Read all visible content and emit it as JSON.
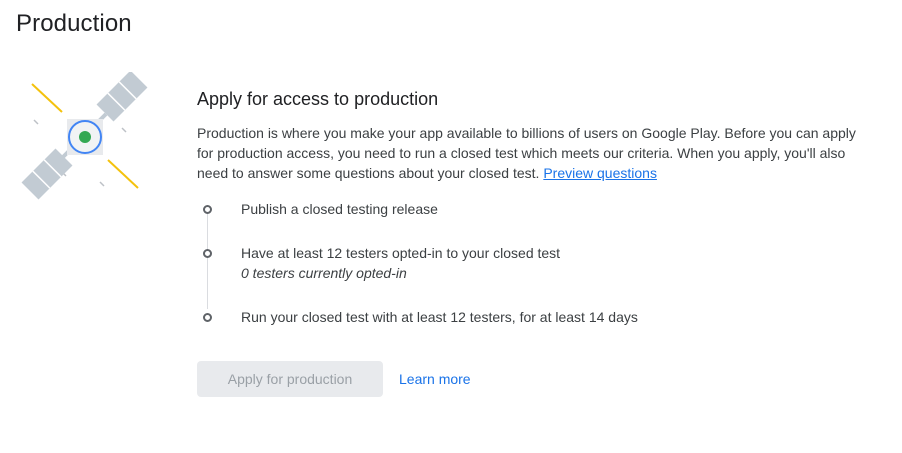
{
  "page": {
    "title": "Production"
  },
  "illustration": {
    "icon": "satellite-icon",
    "accent": "#34a853",
    "ring": "#4285f4"
  },
  "section": {
    "title": "Apply for access to production",
    "description": "Production is where you make your app available to billions of users on Google Play. Before you can apply for production access, you need to run a closed test which meets our criteria. When you apply, you'll also need to answer some questions about your closed test.",
    "preview_link": "Preview questions"
  },
  "steps": [
    {
      "label": "Publish a closed testing release",
      "sub": ""
    },
    {
      "label": "Have at least 12 testers opted-in to your closed test",
      "sub": "0 testers currently opted-in"
    },
    {
      "label": "Run your closed test with at least 12 testers, for at least 14 days",
      "sub": ""
    }
  ],
  "actions": {
    "apply_label": "Apply for production",
    "learn_more": "Learn more"
  },
  "colors": {
    "link": "#1a73e8",
    "disabled_bg": "#e8eaed",
    "disabled_text": "#9aa0a6"
  }
}
